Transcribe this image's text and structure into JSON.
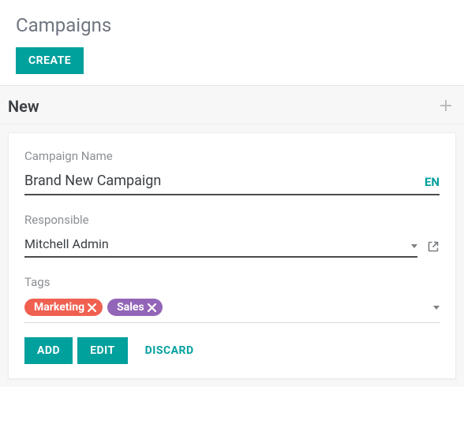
{
  "header": {
    "title": "Campaigns",
    "create_label": "CREATE"
  },
  "stage": {
    "title": "New"
  },
  "form": {
    "name_label": "Campaign Name",
    "name_value": "Brand New Campaign",
    "lang_badge": "EN",
    "responsible_label": "Responsible",
    "responsible_value": "Mitchell Admin",
    "tags_label": "Tags",
    "tags": [
      {
        "label": "Marketing",
        "color": "red"
      },
      {
        "label": "Sales",
        "color": "purple"
      }
    ],
    "actions": {
      "add": "ADD",
      "edit": "EDIT",
      "discard": "DISCARD"
    }
  }
}
